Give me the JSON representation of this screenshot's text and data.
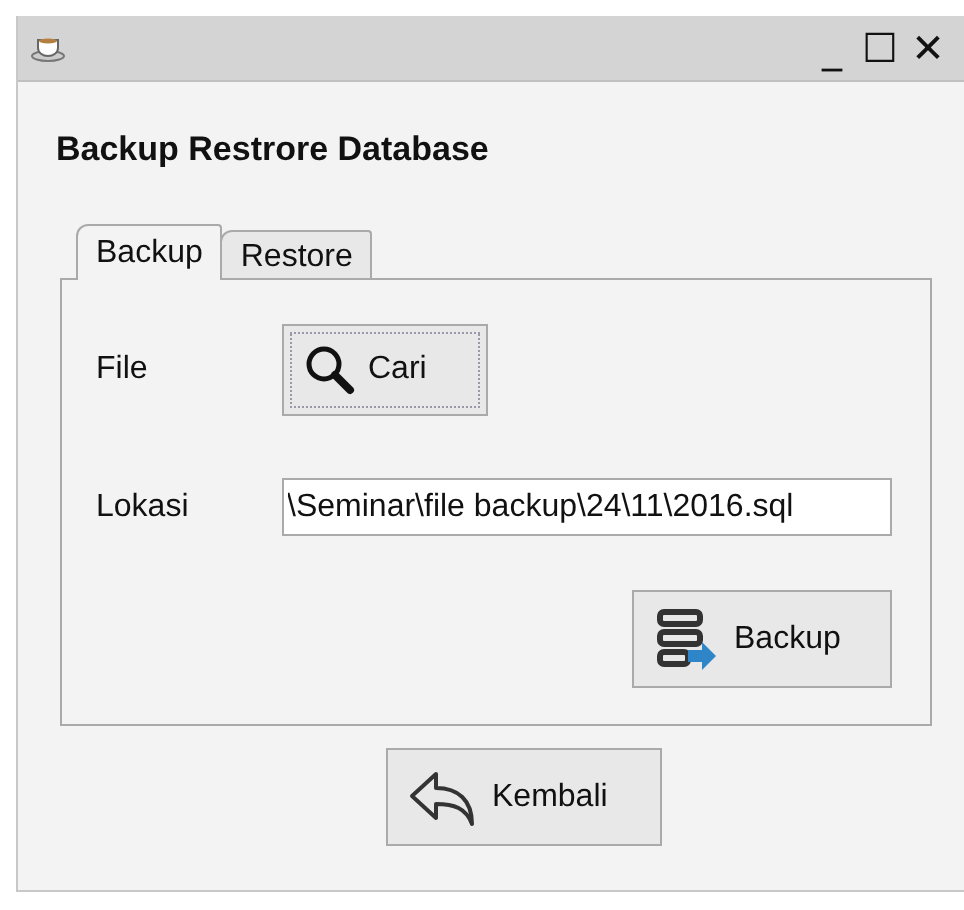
{
  "window": {
    "title_bar_buttons": [
      "_",
      "☐",
      "✕"
    ]
  },
  "heading": "Backup Restrore Database",
  "tabs": [
    {
      "label": "Backup",
      "selected": true
    },
    {
      "label": "Restore",
      "selected": false
    }
  ],
  "file": {
    "label": "File",
    "button": "Cari"
  },
  "location": {
    "label": "Lokasi",
    "value": "\\Seminar\\file backup\\24\\11\\2016.sql"
  },
  "backup_button": "Backup",
  "back_button": "Kembali"
}
